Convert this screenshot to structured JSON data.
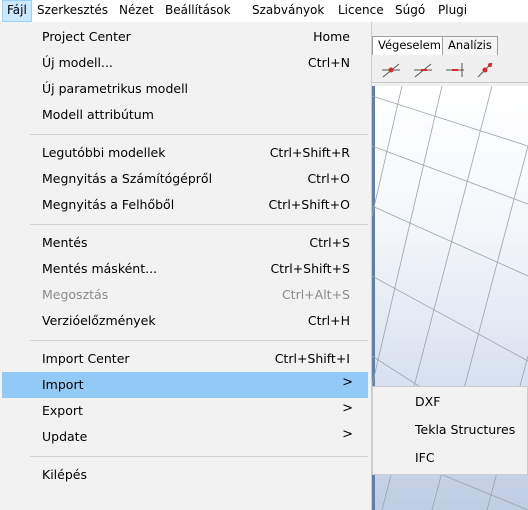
{
  "menubar": {
    "items": [
      "Fájl",
      "Szerkesztés",
      "Nézet",
      "Beállítások",
      "Szabványok",
      "Licence",
      "Súgó",
      "Plugi"
    ]
  },
  "tabs": [
    "Végeselem",
    "Analízis"
  ],
  "menu": {
    "items": [
      {
        "label": "Project Center",
        "shortcut": "Home"
      },
      {
        "label": "Új modell...",
        "shortcut": "Ctrl+N"
      },
      {
        "label": "Új parametrikus modell",
        "shortcut": ""
      },
      {
        "label": "Modell attribútum",
        "shortcut": ""
      },
      {
        "label": "Legutóbbi modellek",
        "shortcut": "Ctrl+Shift+R"
      },
      {
        "label": "Megnyitás a Számítógépről",
        "shortcut": "Ctrl+O"
      },
      {
        "label": "Megnyitás a Felhőből",
        "shortcut": "Ctrl+Shift+O"
      },
      {
        "label": "Mentés",
        "shortcut": "Ctrl+S"
      },
      {
        "label": "Mentés másként...",
        "shortcut": "Ctrl+Shift+S"
      },
      {
        "label": "Megosztás",
        "shortcut": "Ctrl+Alt+S",
        "disabled": true
      },
      {
        "label": "Verzióelőzmények",
        "shortcut": "Ctrl+H"
      },
      {
        "label": "Import Center",
        "shortcut": "Ctrl+Shift+I"
      },
      {
        "label": "Import",
        "arrow": ">",
        "highlighted": true
      },
      {
        "label": "Export",
        "arrow": ">"
      },
      {
        "label": "Update",
        "arrow": ">"
      },
      {
        "label": "Kilépés",
        "shortcut": ""
      }
    ]
  },
  "submenu": {
    "items": [
      "DXF",
      "Tekla Structures",
      "IFC"
    ]
  },
  "icons": {
    "toolbar": [
      "line-tool-icon",
      "diagonal-line-icon",
      "horizontal-line-icon",
      "node-tool-icon"
    ]
  },
  "colors": {
    "highlight": "#91c9f7",
    "menubar_active": "#cce8ff",
    "viewport_bottom": "#bfcde3"
  }
}
